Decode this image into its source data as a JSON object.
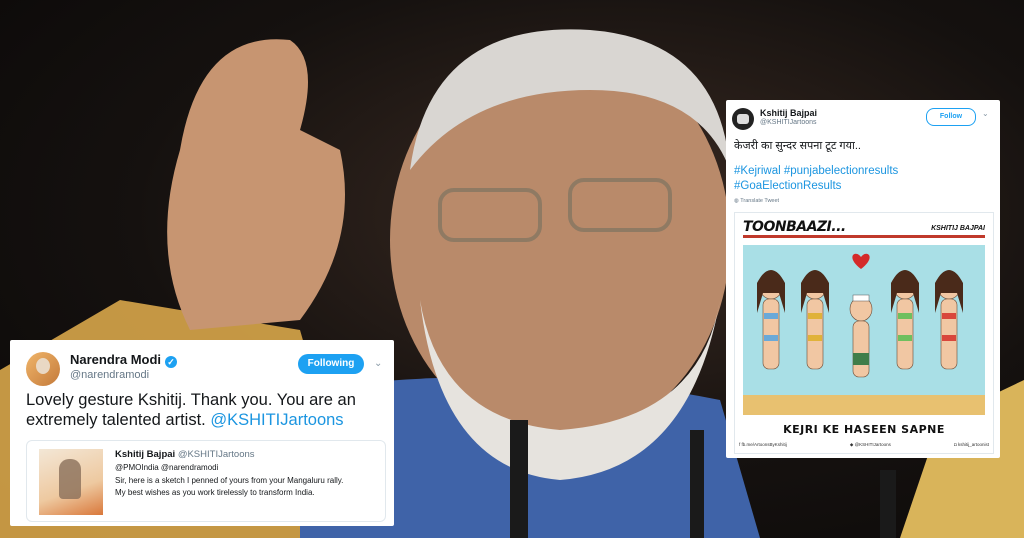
{
  "left_tweet": {
    "author_name": "Narendra Modi",
    "author_handle": "@narendramodi",
    "follow_label": "Following",
    "text_main": "Lovely gesture Kshitij. Thank you. You are an extremely talented artist.",
    "text_link": "@KSHITIJartoons",
    "quoted": {
      "author_name": "Kshitij Bajpai",
      "author_handle": "@KSHITIJartoons",
      "reply_to": "@PMOIndia @narendramodi",
      "line1": "Sir, here is a sketch I penned of yours from your Mangaluru rally.",
      "line2": "My best wishes as you work tirelessly to transform India."
    }
  },
  "right_tweet": {
    "author_name": "Kshitij Bajpai",
    "author_handle": "@KSHITIJartoons",
    "follow_label": "Follow",
    "text": "केजरी का सुन्दर सपना टूट गया..",
    "hashtags_line1": "#Kejriwal #punjabelectionresults",
    "hashtags_line2": "#GoaElectionResults",
    "translate_label": "Translate Tweet",
    "cartoon": {
      "title": "TOONBAAZI...",
      "author": "KSHITIJ BAJPAI",
      "caption": "KEJRI KE HASEEN SAPNE",
      "footer_fb": "fb.me/ArtoonsByKshitij",
      "footer_tw": "@KSHITIJartoons",
      "footer_ig": "kshitij_artoonist"
    }
  },
  "colors": {
    "twitter_blue": "#1da1f2",
    "link_blue": "#1b95e0"
  }
}
